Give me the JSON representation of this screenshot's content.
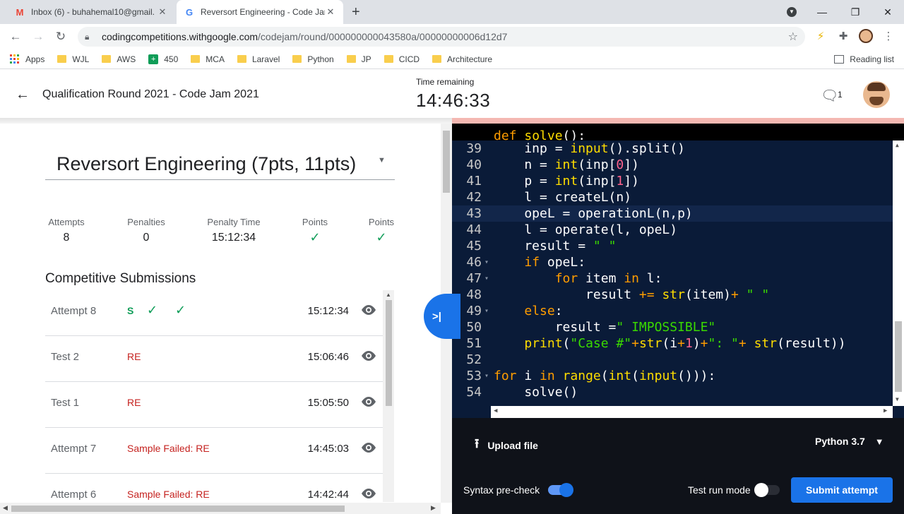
{
  "browser": {
    "tabs": [
      {
        "title": "Inbox (6) - buhahemal10@gmail.",
        "favicon": "gmail-icon",
        "active": false
      },
      {
        "title": "Reversort Engineering - Code Jar",
        "favicon": "google-icon",
        "active": true
      }
    ],
    "url_host": "codingcompetitions.withgoogle.com",
    "url_path": "/codejam/round/000000000043580a/00000000006d12d7",
    "bookmarks": [
      "Apps",
      "WJL",
      "AWS",
      "450",
      "MCA",
      "Laravel",
      "Python",
      "JP",
      "CICD",
      "Architecture"
    ],
    "reading_list": "Reading list"
  },
  "header": {
    "title": "Qualification Round 2021 - Code Jam 2021",
    "time_label": "Time remaining",
    "time_value": "14:46:33",
    "chat_count": "1"
  },
  "problem": {
    "title": "Reversort Engineering (7pts, 11pts)",
    "stats": [
      {
        "label": "Attempts",
        "value": "8"
      },
      {
        "label": "Penalties",
        "value": "0"
      },
      {
        "label": "Penalty Time",
        "value": "15:12:34"
      },
      {
        "label": "Points",
        "value": "check"
      },
      {
        "label": "Points",
        "value": "check"
      }
    ]
  },
  "submissions": {
    "title": "Competitive Submissions",
    "rows": [
      {
        "name": "Attempt 8",
        "result": "S",
        "checks": 2,
        "time": "15:12:34"
      },
      {
        "name": "Test 2",
        "result": "RE",
        "checks": 0,
        "time": "15:06:46"
      },
      {
        "name": "Test 1",
        "result": "RE",
        "checks": 0,
        "time": "15:05:50"
      },
      {
        "name": "Attempt 7",
        "result": "Sample Failed: RE",
        "checks": 0,
        "time": "14:45:03"
      },
      {
        "name": "Attempt 6",
        "result": "Sample Failed: RE",
        "checks": 0,
        "time": "14:42:44"
      }
    ]
  },
  "editor": {
    "partial_top_line": "def solve():",
    "lines": [
      {
        "n": "39",
        "fold": false,
        "active": false,
        "html": "    inp = <span class=\"fn\">input</span>().split()"
      },
      {
        "n": "40",
        "fold": false,
        "active": false,
        "html": "    n = <span class=\"fn\">int</span>(inp[<span class=\"num\">0</span>])"
      },
      {
        "n": "41",
        "fold": false,
        "active": false,
        "html": "    p = <span class=\"fn\">int</span>(inp[<span class=\"num\">1</span>])"
      },
      {
        "n": "42",
        "fold": false,
        "active": false,
        "html": "    l = createL(n)"
      },
      {
        "n": "43",
        "fold": false,
        "active": true,
        "html": "    opeL = operationL(n,p)"
      },
      {
        "n": "44",
        "fold": false,
        "active": false,
        "html": "    l = operate(l, opeL)"
      },
      {
        "n": "45",
        "fold": false,
        "active": false,
        "html": "    result = <span class=\"str\">\" \"</span>"
      },
      {
        "n": "46",
        "fold": true,
        "active": false,
        "html": "    <span class=\"kw\">if</span> opeL:"
      },
      {
        "n": "47",
        "fold": true,
        "active": false,
        "html": "        <span class=\"kw\">for</span> item <span class=\"kw\">in</span> l:"
      },
      {
        "n": "48",
        "fold": false,
        "active": false,
        "html": "            result <span class=\"op\">+=</span> <span class=\"fn\">str</span>(item)<span class=\"op\">+</span> <span class=\"str\">\" \"</span>"
      },
      {
        "n": "49",
        "fold": true,
        "active": false,
        "html": "    <span class=\"kw\">else</span>:"
      },
      {
        "n": "50",
        "fold": false,
        "active": false,
        "html": "        result =<span class=\"str\">\" IMPOSSIBLE\"</span>"
      },
      {
        "n": "51",
        "fold": false,
        "active": false,
        "html": "    <span class=\"fn\">print</span>(<span class=\"str\">\"Case #\"</span><span class=\"op\">+</span><span class=\"fn\">str</span>(i<span class=\"op\">+</span><span class=\"num\">1</span>)<span class=\"op\">+</span><span class=\"str\">\": \"</span><span class=\"op\">+</span> <span class=\"fn\">str</span>(result))"
      },
      {
        "n": "52",
        "fold": false,
        "active": false,
        "html": ""
      },
      {
        "n": "53",
        "fold": true,
        "active": false,
        "html": "<span class=\"kw\">for</span> i <span class=\"kw\">in</span> <span class=\"fn\">range</span>(<span class=\"fn\">int</span>(<span class=\"fn\">input</span>())):"
      },
      {
        "n": "54",
        "fold": false,
        "active": false,
        "html": "    solve()"
      }
    ]
  },
  "controls": {
    "upload_label": "Upload file",
    "language": "Python 3.7",
    "syntax_label": "Syntax pre-check",
    "syntax_on": true,
    "testrun_label": "Test run mode",
    "testrun_on": false,
    "submit_label": "Submit attempt"
  },
  "colors": {
    "accent": "#1a73e8",
    "success": "#0f9d58",
    "error": "#c5221f",
    "editor_bg": "#0a1b38"
  }
}
